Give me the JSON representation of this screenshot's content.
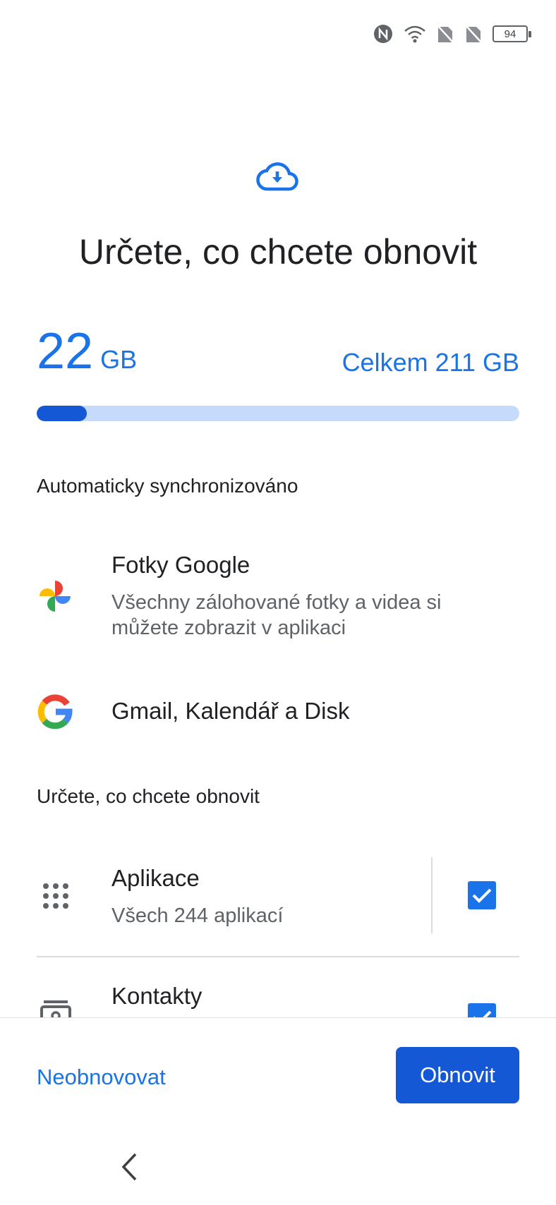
{
  "status_bar": {
    "icons": [
      "nfc-icon",
      "wifi-icon",
      "no-sim-icon",
      "no-sim-icon"
    ],
    "battery_level": "94"
  },
  "header": {
    "icon": "cloud-download-icon",
    "title": "Určete, co chcete obnovit"
  },
  "storage": {
    "used_value": "22",
    "used_unit": "GB",
    "total_label": "Celkem 211 GB",
    "used_fraction": 0.104,
    "fill_color": "#1558d6",
    "track_color": "#c6dafc"
  },
  "auto_sync": {
    "heading": "Automaticky synchronizováno",
    "items": [
      {
        "icon": "google-photos-icon",
        "title": "Fotky Google",
        "subtitle": "Všechny zálohované fotky a videa si můžete zobrazit v aplikaci"
      },
      {
        "icon": "google-g-icon",
        "title": "Gmail, Kalendář a Disk"
      }
    ]
  },
  "restore": {
    "heading": "Určete, co chcete obnovit",
    "items": [
      {
        "icon": "apps-grid-icon",
        "title": "Aplikace",
        "subtitle": "Všech 244 aplikací",
        "checked": true
      },
      {
        "icon": "contacts-icon",
        "title": "Kontakty",
        "checked": true
      }
    ]
  },
  "footer": {
    "skip_label": "Neobnovovat",
    "restore_label": "Obnovit"
  },
  "nav": {
    "back_icon": "back-chevron-icon"
  },
  "colors": {
    "accent": "#1a73e8",
    "primary_button": "#1558d6"
  }
}
